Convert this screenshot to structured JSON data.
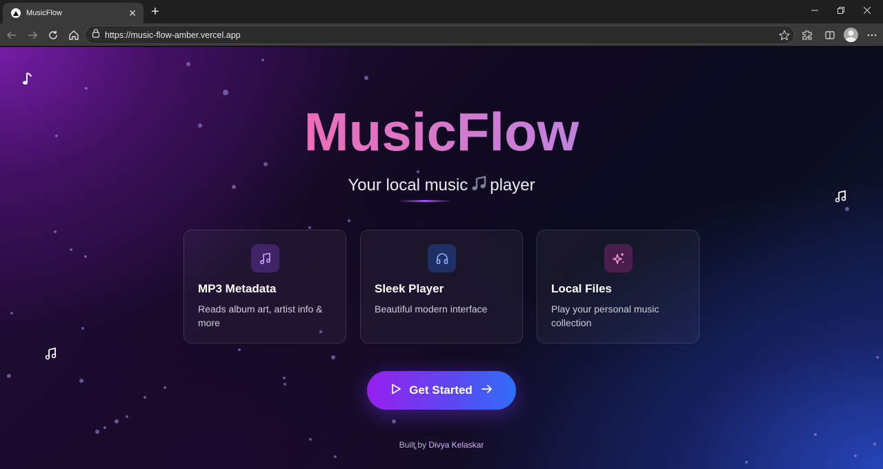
{
  "browser": {
    "tab_title": "MusicFlow",
    "url": "https://music-flow-amber.vercel.app",
    "icons": [
      "back-icon",
      "forward-icon",
      "reload-icon",
      "home-icon",
      "site-info-icon",
      "favorite-star-icon",
      "extensions-icon",
      "split-screen-icon",
      "profile-avatar",
      "more-menu-icon",
      "minimize-icon",
      "restore-icon",
      "close-window-icon",
      "new-tab-icon"
    ]
  },
  "hero": {
    "title": "MusicFlow",
    "subtitle_before": "Your local music",
    "subtitle_after": "player"
  },
  "features": [
    {
      "title": "MP3 Metadata",
      "description": "Reads album art, artist info & more",
      "icon": "music-note-icon",
      "icon_color": "#c7a6ff",
      "icon_bg": "#3f2468"
    },
    {
      "title": "Sleek Player",
      "description": "Beautiful modern interface",
      "icon": "headphones-icon",
      "icon_color": "#8fb4ff",
      "icon_bg": "#1f3064"
    },
    {
      "title": "Local Files",
      "description": "Play your personal music collection",
      "icon": "sparkles-icon",
      "icon_color": "#f59ad0",
      "icon_bg": "#4a1f4e"
    }
  ],
  "cta": {
    "label": "Get Started"
  },
  "footer": {
    "prefix": "Built by",
    "author": "Divya Kelaskar"
  },
  "colors": {
    "title_gradient_start": "#ec4fa0",
    "title_gradient_end": "#8f94f0",
    "cta_gradient_start": "#9620ef",
    "cta_gradient_end": "#2f6ff5"
  }
}
